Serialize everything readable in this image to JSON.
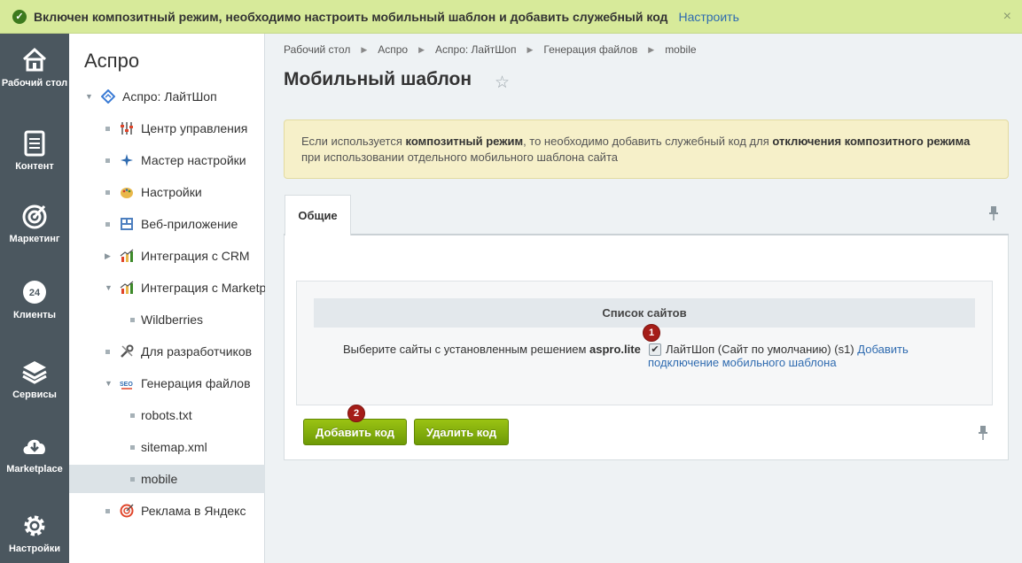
{
  "notice": {
    "text": "Включен композитный режим, необходимо настроить мобильный шаблон и добавить служебный код",
    "configure_label": "Настроить",
    "close_symbol": "×"
  },
  "rail": [
    {
      "label": "Рабочий стол",
      "icon": "home-icon"
    },
    {
      "label": "Контент",
      "icon": "document-icon"
    },
    {
      "label": "Маркетинг",
      "icon": "target-icon"
    },
    {
      "label": "Клиенты",
      "icon": "clock-24-icon"
    },
    {
      "label": "Сервисы",
      "icon": "layers-icon"
    },
    {
      "label": "Marketplace",
      "icon": "cloud-download-icon"
    },
    {
      "label": "Настройки",
      "icon": "gear-icon"
    }
  ],
  "sidebar": {
    "title": "Аспро",
    "items": [
      {
        "label": "Аспро: ЛайтШоп"
      },
      {
        "label": "Центр управления"
      },
      {
        "label": "Мастер настройки"
      },
      {
        "label": "Настройки"
      },
      {
        "label": "Веб-приложение"
      },
      {
        "label": "Интеграция с CRM"
      },
      {
        "label": "Интеграция с Marketplace"
      },
      {
        "label": "Wildberries"
      },
      {
        "label": "Для разработчиков"
      },
      {
        "label": "Генерация файлов"
      },
      {
        "label": "robots.txt"
      },
      {
        "label": "sitemap.xml"
      },
      {
        "label": "mobile"
      },
      {
        "label": "Реклама в Яндекс"
      }
    ]
  },
  "breadcrumbs": [
    "Рабочий стол",
    "Аспро",
    "Аспро: ЛайтШоп",
    "Генерация файлов",
    "mobile"
  ],
  "page_title": "Мобильный шаблон",
  "info_note": {
    "part1": "Если используется ",
    "bold1": "композитный режим",
    "part2": ", то необходимо добавить служебный код для ",
    "bold2": "отключения композитного режима",
    "part3": " при использовании отдельного мобильного шаблона сайта"
  },
  "tabs": [
    {
      "label": "Общие"
    }
  ],
  "sites_section": {
    "header": "Список сайтов",
    "label_prefix": "Выберите сайты с установленным решением ",
    "label_bold": "aspro.lite",
    "site_name": "ЛайтШоп (Сайт по умолчанию) (s1)",
    "checked": true,
    "check_mark": "✔",
    "link_line1": "Добавить",
    "link_line2": "подключение мобильного шаблона"
  },
  "buttons": {
    "add": "Добавить код",
    "remove": "Удалить код"
  },
  "badges": [
    "1",
    "2"
  ]
}
